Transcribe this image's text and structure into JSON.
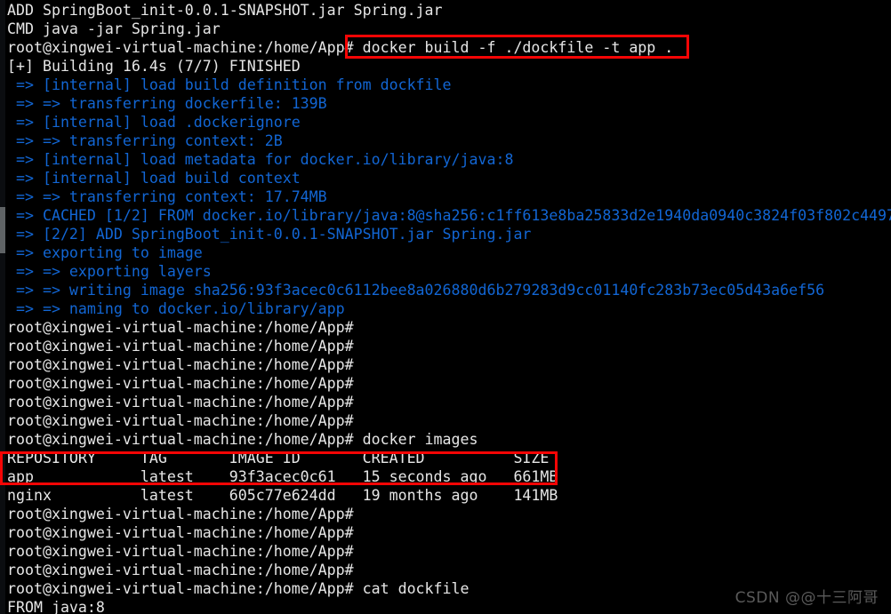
{
  "terminal": {
    "background_color": "#000000",
    "text_color": "#d8d8d8",
    "build_output_color": "#1266d4",
    "highlight_color": "#f50505",
    "prompt": "root@xingwei-virtual-machine:/home/App#",
    "lines": [
      {
        "text": "ADD SpringBoot_init-0.0.1-SNAPSHOT.jar Spring.jar",
        "color": "white"
      },
      {
        "text": "CMD java -jar Spring.jar",
        "color": "white"
      },
      {
        "text": "root@xingwei-virtual-machine:/home/App# docker build -f ./dockfile -t app .",
        "color": "white"
      },
      {
        "text": "[+] Building 16.4s (7/7) FINISHED",
        "color": "white"
      },
      {
        "text": " => [internal] load build definition from dockfile",
        "color": "blue"
      },
      {
        "text": " => => transferring dockerfile: 139B",
        "color": "blue"
      },
      {
        "text": " => [internal] load .dockerignore",
        "color": "blue"
      },
      {
        "text": " => => transferring context: 2B",
        "color": "blue"
      },
      {
        "text": " => [internal] load metadata for docker.io/library/java:8",
        "color": "blue"
      },
      {
        "text": " => [internal] load build context",
        "color": "blue"
      },
      {
        "text": " => => transferring context: 17.74MB",
        "color": "blue"
      },
      {
        "text": " => CACHED [1/2] FROM docker.io/library/java:8@sha256:c1ff613e8ba25833d2e1940da0940c3824f03f802c4497",
        "color": "blue"
      },
      {
        "text": " => [2/2] ADD SpringBoot_init-0.0.1-SNAPSHOT.jar Spring.jar",
        "color": "blue"
      },
      {
        "text": " => exporting to image",
        "color": "blue"
      },
      {
        "text": " => => exporting layers",
        "color": "blue"
      },
      {
        "text": " => => writing image sha256:93f3acec0c6112bee8a026880d6b279283d9cc01140fc283b73ec05d43a6ef56",
        "color": "blue"
      },
      {
        "text": " => => naming to docker.io/library/app",
        "color": "blue"
      },
      {
        "text": "root@xingwei-virtual-machine:/home/App#",
        "color": "white"
      },
      {
        "text": "root@xingwei-virtual-machine:/home/App#",
        "color": "white"
      },
      {
        "text": "root@xingwei-virtual-machine:/home/App#",
        "color": "white"
      },
      {
        "text": "root@xingwei-virtual-machine:/home/App#",
        "color": "white"
      },
      {
        "text": "root@xingwei-virtual-machine:/home/App#",
        "color": "white"
      },
      {
        "text": "root@xingwei-virtual-machine:/home/App#",
        "color": "white"
      },
      {
        "text": "root@xingwei-virtual-machine:/home/App# docker images",
        "color": "white"
      },
      {
        "text": "REPOSITORY     TAG       IMAGE ID       CREATED          SIZE",
        "color": "white"
      },
      {
        "text": "app            latest    93f3acec0c61   15 seconds ago   661MB",
        "color": "white"
      },
      {
        "text": "nginx          latest    605c77e624dd   19 months ago    141MB",
        "color": "white"
      },
      {
        "text": "root@xingwei-virtual-machine:/home/App#",
        "color": "white"
      },
      {
        "text": "root@xingwei-virtual-machine:/home/App#",
        "color": "white"
      },
      {
        "text": "root@xingwei-virtual-machine:/home/App#",
        "color": "white"
      },
      {
        "text": "root@xingwei-virtual-machine:/home/App#",
        "color": "white"
      },
      {
        "text": "root@xingwei-virtual-machine:/home/App# cat dockfile",
        "color": "white"
      },
      {
        "text": "FROM java:8",
        "color": "white"
      }
    ]
  },
  "commands": {
    "docker_build": "docker build -f ./dockfile -t app .",
    "docker_images": "docker images",
    "cat_dockfile": "cat dockfile"
  },
  "build_summary": {
    "status_line": "[+] Building 16.4s (7/7) FINISHED",
    "duration": "16.4s",
    "steps": "7/7",
    "state": "FINISHED",
    "dockerfile_size": "139B",
    "context_size": "17.74MB",
    "dockerignore_context": "2B",
    "base_image": "docker.io/library/java:8",
    "base_image_digest": "sha256:c1ff613e8ba25833d2e1940da0940c3824f03f802c4497",
    "written_image_digest": "sha256:93f3acec0c6112bee8a026880d6b279283d9cc01140fc283b73ec05d43a6ef56",
    "naming": "docker.io/library/app"
  },
  "images_table": {
    "headers": [
      "REPOSITORY",
      "TAG",
      "IMAGE ID",
      "CREATED",
      "SIZE"
    ],
    "rows": [
      {
        "repository": "app",
        "tag": "latest",
        "image_id": "93f3acec0c61",
        "created": "15 seconds ago",
        "size": "661MB"
      },
      {
        "repository": "nginx",
        "tag": "latest",
        "image_id": "605c77e624dd",
        "created": "19 months ago",
        "size": "141MB"
      }
    ]
  },
  "dockerfile_content": {
    "lines": [
      "FROM java:8",
      "ADD SpringBoot_init-0.0.1-SNAPSHOT.jar Spring.jar",
      "CMD java -jar Spring.jar"
    ]
  },
  "annotations": [
    {
      "id": "hl-build-cmd",
      "label": "docker build -f ./dockfile -t app ."
    },
    {
      "id": "hl-images-row",
      "label": "app latest 93f3acec0c61 15 seconds ago 661MB"
    }
  ],
  "watermark": {
    "text": "CSDN @@十三阿哥"
  }
}
